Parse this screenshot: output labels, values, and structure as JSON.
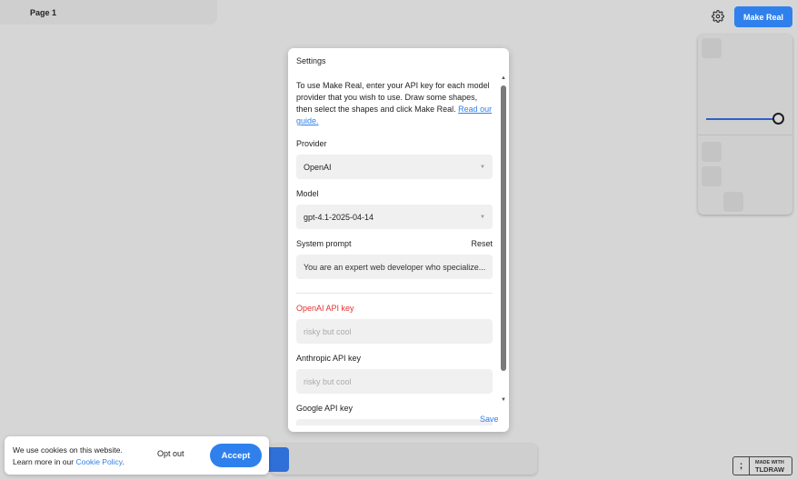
{
  "page_menu": {
    "label": "Page 1"
  },
  "top_right": {
    "make_real_label": "Make Real",
    "settings_icon": "gear-icon"
  },
  "dialog": {
    "title": "Settings",
    "description": "To use Make Real, enter your API key for each model provider that you wish to use. Draw some shapes, then select the shapes and click Make Real.",
    "guide_link": "Read our guide.",
    "provider": {
      "label": "Provider",
      "value": "OpenAI"
    },
    "model": {
      "label": "Model",
      "value": "gpt-4.1-2025-04-14"
    },
    "system_prompt": {
      "label": "System prompt",
      "reset_label": "Reset",
      "value": "You are an expert web developer who specialize..."
    },
    "openai_key": {
      "label": "OpenAI API key",
      "placeholder": "risky but cool"
    },
    "anthropic_key": {
      "label": "Anthropic API key",
      "placeholder": "risky but cool"
    },
    "google_key": {
      "label": "Google API key"
    },
    "save_label": "Save"
  },
  "cookie_banner": {
    "line1": "We use cookies on this website.",
    "line2_prefix": "Learn more in our",
    "policy_link": "Cookie Policy",
    "line2_suffix": ".",
    "opt_out_label": "Opt out",
    "accept_label": "Accept"
  },
  "badge": {
    "line1": "MADE WITH",
    "line2": "TLDRAW"
  },
  "colors": {
    "accent": "#2f80ed",
    "error": "#e03131"
  }
}
